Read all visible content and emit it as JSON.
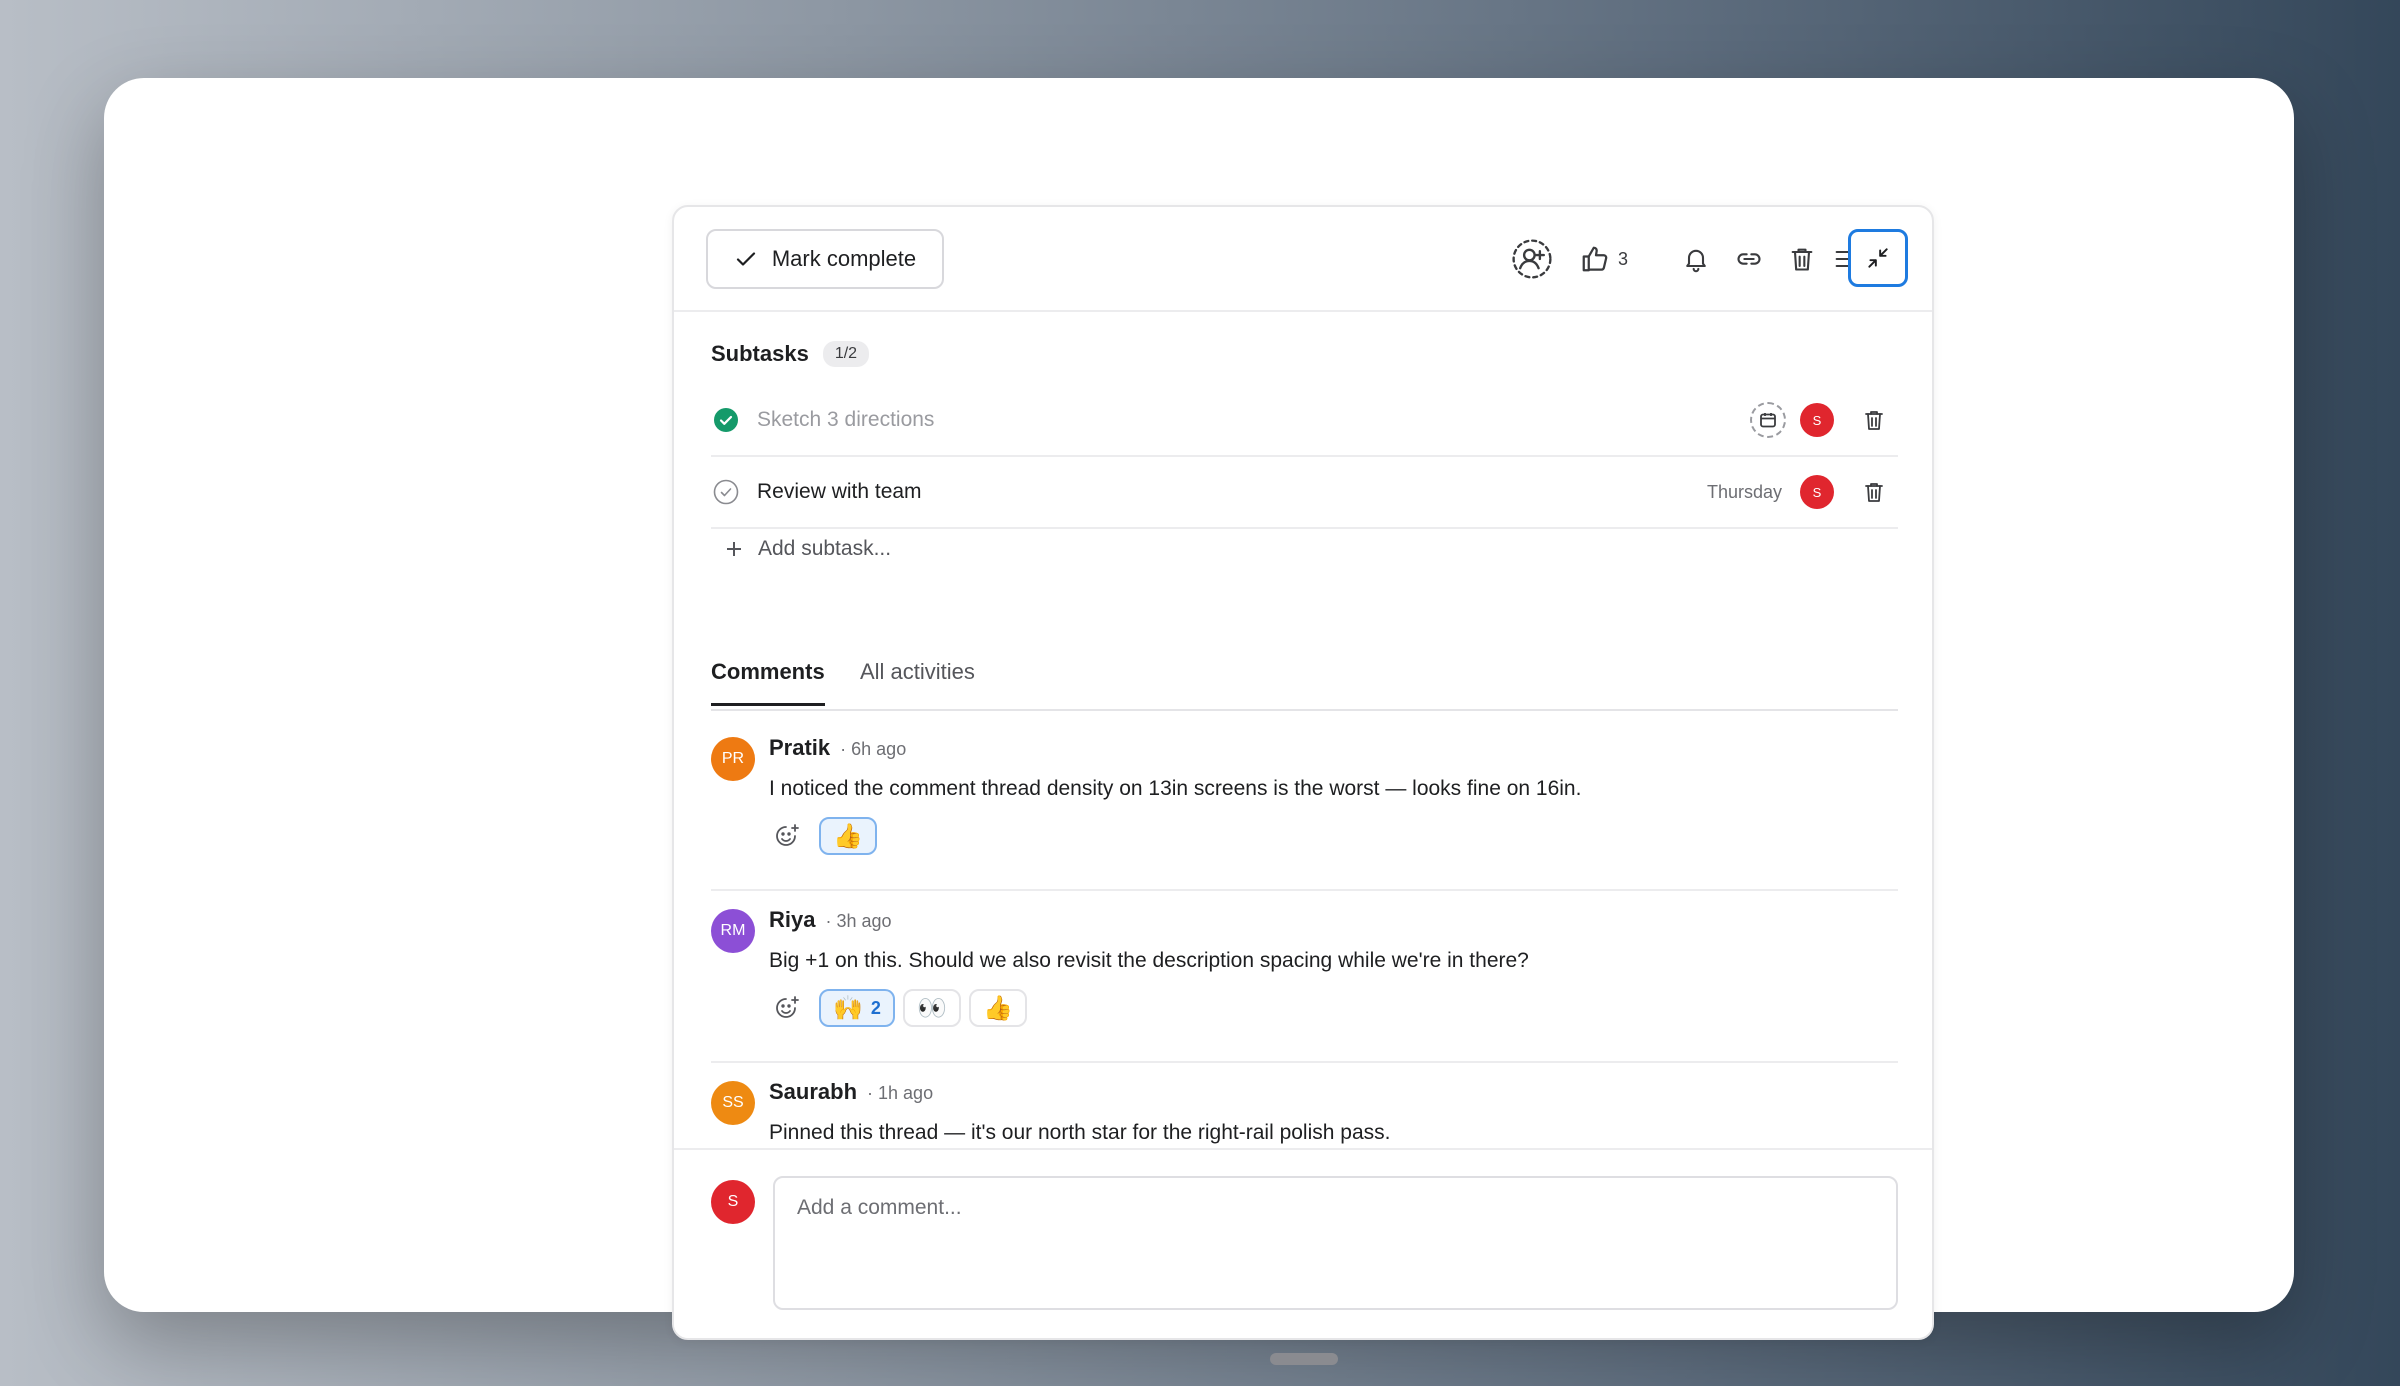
{
  "toolbar": {
    "mark_complete_label": "Mark complete",
    "like_count": "3",
    "icons": [
      "add-collaborator-icon",
      "thumbs-up-icon",
      "bell-icon",
      "link-icon",
      "trash-icon",
      "menu-icon",
      "collapse-icon"
    ]
  },
  "subtasks": {
    "title": "Subtasks",
    "count": "1/2",
    "items": [
      {
        "name": "Sketch 3 directions",
        "done": true,
        "due": "",
        "assignee_initial": "S"
      },
      {
        "name": "Review with team",
        "done": false,
        "due": "Thursday",
        "assignee_initial": "S"
      }
    ],
    "add_label": "Add subtask..."
  },
  "tabs": {
    "comments": "Comments",
    "all_activities": "All activities"
  },
  "comments": [
    {
      "initials": "PR",
      "author": "Pratik",
      "time": "· 6h ago",
      "avatar_color": "#ee7a12",
      "text": "I noticed the comment thread density on 13in screens is the worst — looks fine on 16in.",
      "reactions": [
        {
          "emoji": "👍",
          "count": "",
          "active": true
        }
      ]
    },
    {
      "initials": "RM",
      "author": "Riya",
      "time": "· 3h ago",
      "avatar_color": "#8c4fd6",
      "text": "Big +1 on this. Should we also revisit the description spacing while we're in there?",
      "reactions": [
        {
          "emoji": "🙌",
          "count": "2",
          "active": true
        },
        {
          "emoji": "👀",
          "count": "",
          "active": false
        },
        {
          "emoji": "👍",
          "count": "",
          "active": false
        }
      ]
    },
    {
      "initials": "SS",
      "author": "Saurabh",
      "time": "· 1h ago",
      "avatar_color": "#ee8a12",
      "text": "Pinned this thread — it's our north star for the right-rail polish pass.",
      "reactions": []
    }
  ],
  "composer": {
    "avatar_initial": "S",
    "placeholder": "Add a comment..."
  },
  "colors": {
    "accent": "#1e7be0",
    "complete_green": "#159a6a",
    "assignee_red": "#e0262e"
  }
}
